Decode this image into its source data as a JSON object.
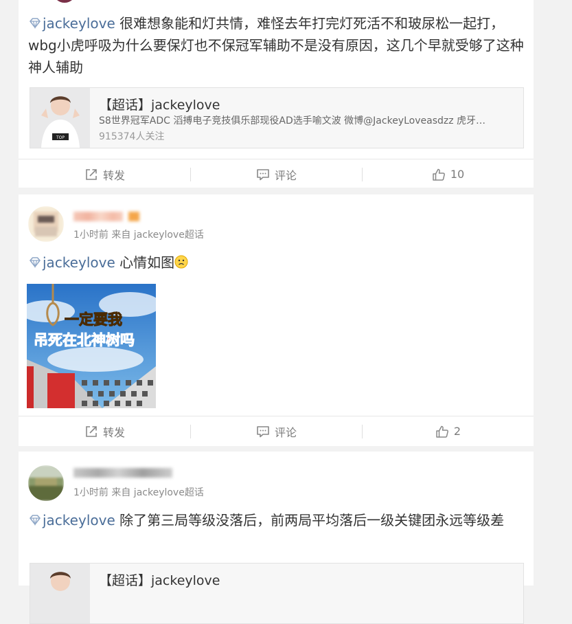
{
  "hashtag": "jackeylove",
  "posts": [
    {
      "text": "很难想象能和灯共情，难怪去年打完灯死活不和玻尿松一起打，wbg小虎呼吸为什么要保灯也不保冠军辅助不是没有原因，这几个早就受够了这种神人辅助",
      "supertopic": {
        "title": "【超话】jackeylove",
        "desc": "S8世界冠军ADC 滔搏电子竞技俱乐部现役AD选手喻文波 微博@JackeyLoveasdzz 虎牙…",
        "fans": "915374人关注"
      },
      "actions": {
        "repost": "转发",
        "comment": "评论",
        "likes": "10"
      }
    },
    {
      "meta": "1小时前 来自 jackeylove超话",
      "text": "心情如图",
      "image_text": [
        "一定要我",
        "吊死在北神树吗"
      ],
      "actions": {
        "repost": "转发",
        "comment": "评论",
        "likes": "2"
      }
    },
    {
      "meta": "1小时前 来自 jackeylove超话",
      "text": "除了第三局等级没落后，前两局平均落后一级关键团永远等级差",
      "supertopic": {
        "title": "【超话】jackeylove"
      }
    }
  ],
  "colors": {
    "accent": "#4b6e99",
    "bg": "#f2f2f2",
    "muted": "#8a8a8a",
    "imageBanner": "#ffe800",
    "imageBannerRed": "#ff3b2f"
  },
  "icons": [
    "gem-icon",
    "repost-icon",
    "comment-icon",
    "like-icon",
    "frown-emoji-icon"
  ]
}
